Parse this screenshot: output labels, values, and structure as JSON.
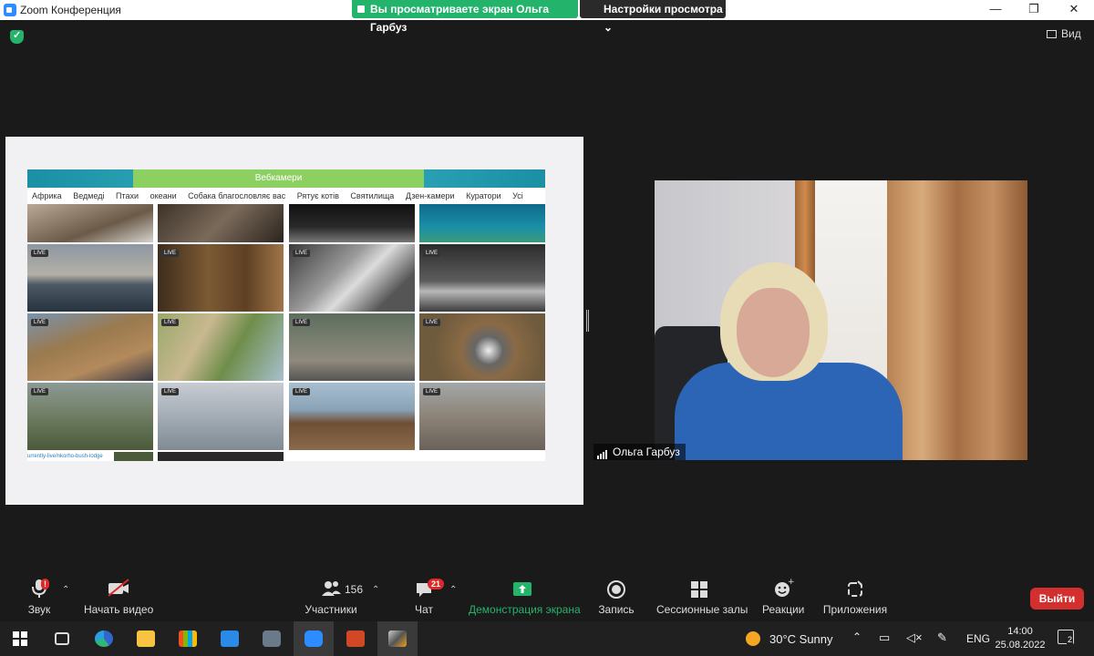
{
  "window": {
    "title": "Zoom Конференция",
    "controls": {
      "minimize": "—",
      "restore": "❐",
      "close": "✕"
    }
  },
  "share_banner": {
    "text": "Вы просматриваете экран Ольга Гарбуз",
    "view_settings": "Настройки просмотра ⌄"
  },
  "top_right": {
    "view_label": "Вид"
  },
  "shared_screen": {
    "site_banner": "Вебкамери",
    "nav": [
      "Африка",
      "Ведмеді",
      "Птахи",
      "океани",
      "Собака благословляє вас",
      "Рятує котів",
      "Святилища",
      "Дзен-камери",
      "Куратори",
      "Усі"
    ],
    "live_label": "LIVE",
    "url_text": "urrently-live/nkorho-bush-lodge"
  },
  "participant": {
    "name": "Ольга Гарбуз"
  },
  "toolbar": {
    "audio": "Звук",
    "video": "Начать видео",
    "participants": "Участники",
    "participants_count": "156",
    "chat": "Чат",
    "chat_badge": "21",
    "share": "Демонстрация экрана",
    "record": "Запись",
    "breakout": "Сессионные залы",
    "reactions": "Реакции",
    "apps": "Приложения",
    "leave": "Выйти",
    "audio_alert": "!"
  },
  "taskbar": {
    "weather": "30°C  Sunny",
    "language": "ENG",
    "time": "14:00",
    "date": "25.08.2022",
    "notifications": "2"
  },
  "colors": {
    "accent_green": "#23b36a",
    "leave_red": "#d32f2f",
    "badge_red": "#e02828"
  }
}
